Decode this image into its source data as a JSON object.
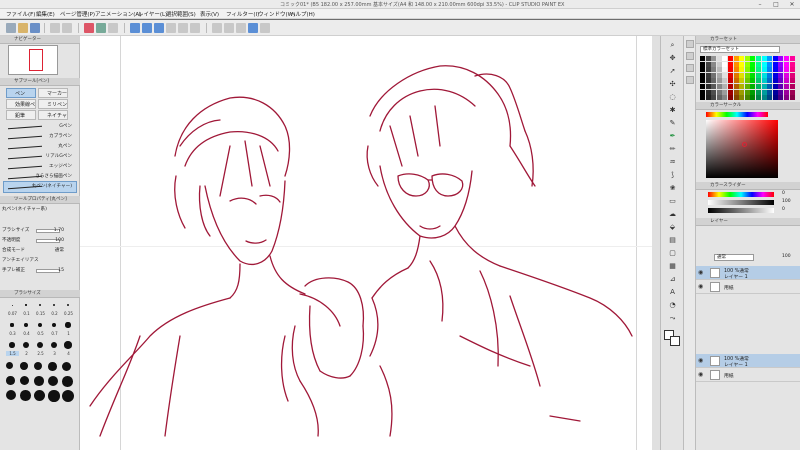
{
  "window": {
    "title": "コミック01* (B5 182.00 x 257.00mm 基本サイズ(A4 和 148.00 x 210.00mm 600dpi 33.5%) - CLIP STUDIO PAINT EX"
  },
  "menu": {
    "items": [
      "ファイル(F)",
      "編集(E)",
      "ページ管理(P)",
      "アニメーション(A)",
      "レイヤー(L)",
      "選択範囲(S)",
      "表示(V)",
      "フィルター(I)",
      "ウィンドウ(W)",
      "ヘルプ(H)"
    ]
  },
  "navigator": {
    "header": "ナビゲーター"
  },
  "subtool": {
    "header": "サブツール[ペン]",
    "tabs": [
      "ペン",
      "マーカー",
      "効果線ペン",
      "ミリペン",
      "鉛筆",
      "ネイチャー"
    ],
    "brushes": [
      "Gペン",
      "カブラペン",
      "丸ペン",
      "リアルGペン",
      "エッジペン",
      "さらさら描画ペン",
      "鉛筆(ぼかし)",
      "丸ペン(ネイチャー)"
    ],
    "active_brush_index": 7
  },
  "tool_property": {
    "header": "ツールプロパティ[丸ペン]",
    "brush_name": "丸ペン(ネイチャー系)",
    "rows": [
      {
        "label": "ブラシサイズ",
        "value": "1.70"
      },
      {
        "label": "不透明度",
        "value": "100"
      },
      {
        "label": "合成モード",
        "value": "通常"
      },
      {
        "label": "アンチエイリアス",
        "value": ""
      },
      {
        "label": "手ブレ補正",
        "value": "15"
      }
    ]
  },
  "brush_size": {
    "header": "ブラシサイズ",
    "labels_row1": [
      "0.07",
      "0.1",
      "0.15",
      "0.2",
      "0.25"
    ],
    "labels_row2": [
      "0.3",
      "0.4",
      "0.5",
      "0.7",
      "1"
    ],
    "labels_row3": [
      "1.5",
      "2",
      "2.5",
      "3",
      "4"
    ],
    "selected": "1.5"
  },
  "color_set": {
    "header": "カラーセット",
    "set_name": "標準カラーセット"
  },
  "color_circle": {
    "header": "カラーサークル"
  },
  "color_slider": {
    "header": "カラースライダー",
    "value_h": "0",
    "value_s": "100",
    "value_v": "0"
  },
  "layer_panel": {
    "header": "レイヤー",
    "blend_mode": "通常",
    "opacity": "100",
    "layers": [
      {
        "line1": "100 %通常",
        "line2": "レイヤー 1",
        "selected": true
      },
      {
        "line1": "",
        "line2": "用紙",
        "selected": false
      },
      {
        "line1": "100 %通常",
        "line2": "レイヤー 1",
        "selected": true
      },
      {
        "line1": "",
        "line2": "用紙",
        "selected": false
      }
    ]
  },
  "canvas": {
    "ink_color": "#a01838",
    "background": "#ffffff"
  },
  "colors": {
    "selection": "#b9d4ee",
    "accent": "#6f9cc9"
  }
}
